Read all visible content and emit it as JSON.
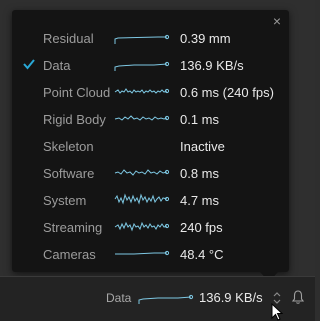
{
  "status_bar": {
    "label": "Data",
    "value": "136.9 KB/s",
    "stepper_icon": "up-down-icon",
    "notifications_icon": "bell-icon"
  },
  "popup": {
    "close_icon": "close-icon",
    "rows": [
      {
        "label": "Residual",
        "value": "0.39 mm",
        "checked": false
      },
      {
        "label": "Data",
        "value": "136.9 KB/s",
        "checked": true
      },
      {
        "label": "Point Cloud",
        "value": "0.6 ms (240 fps)",
        "checked": false
      },
      {
        "label": "Rigid Body",
        "value": "0.1 ms",
        "checked": false
      },
      {
        "label": "Skeleton",
        "value": "Inactive",
        "checked": false
      },
      {
        "label": "Software",
        "value": "0.8 ms",
        "checked": false
      },
      {
        "label": "System",
        "value": "4.7 ms",
        "checked": false
      },
      {
        "label": "Streaming",
        "value": "240 fps",
        "checked": false
      },
      {
        "label": "Cameras",
        "value": "48.4 °C",
        "checked": false
      }
    ]
  },
  "colors": {
    "accent": "#29a8d6",
    "sparkline": "#7ec8e3",
    "popup_bg": "#141414"
  }
}
